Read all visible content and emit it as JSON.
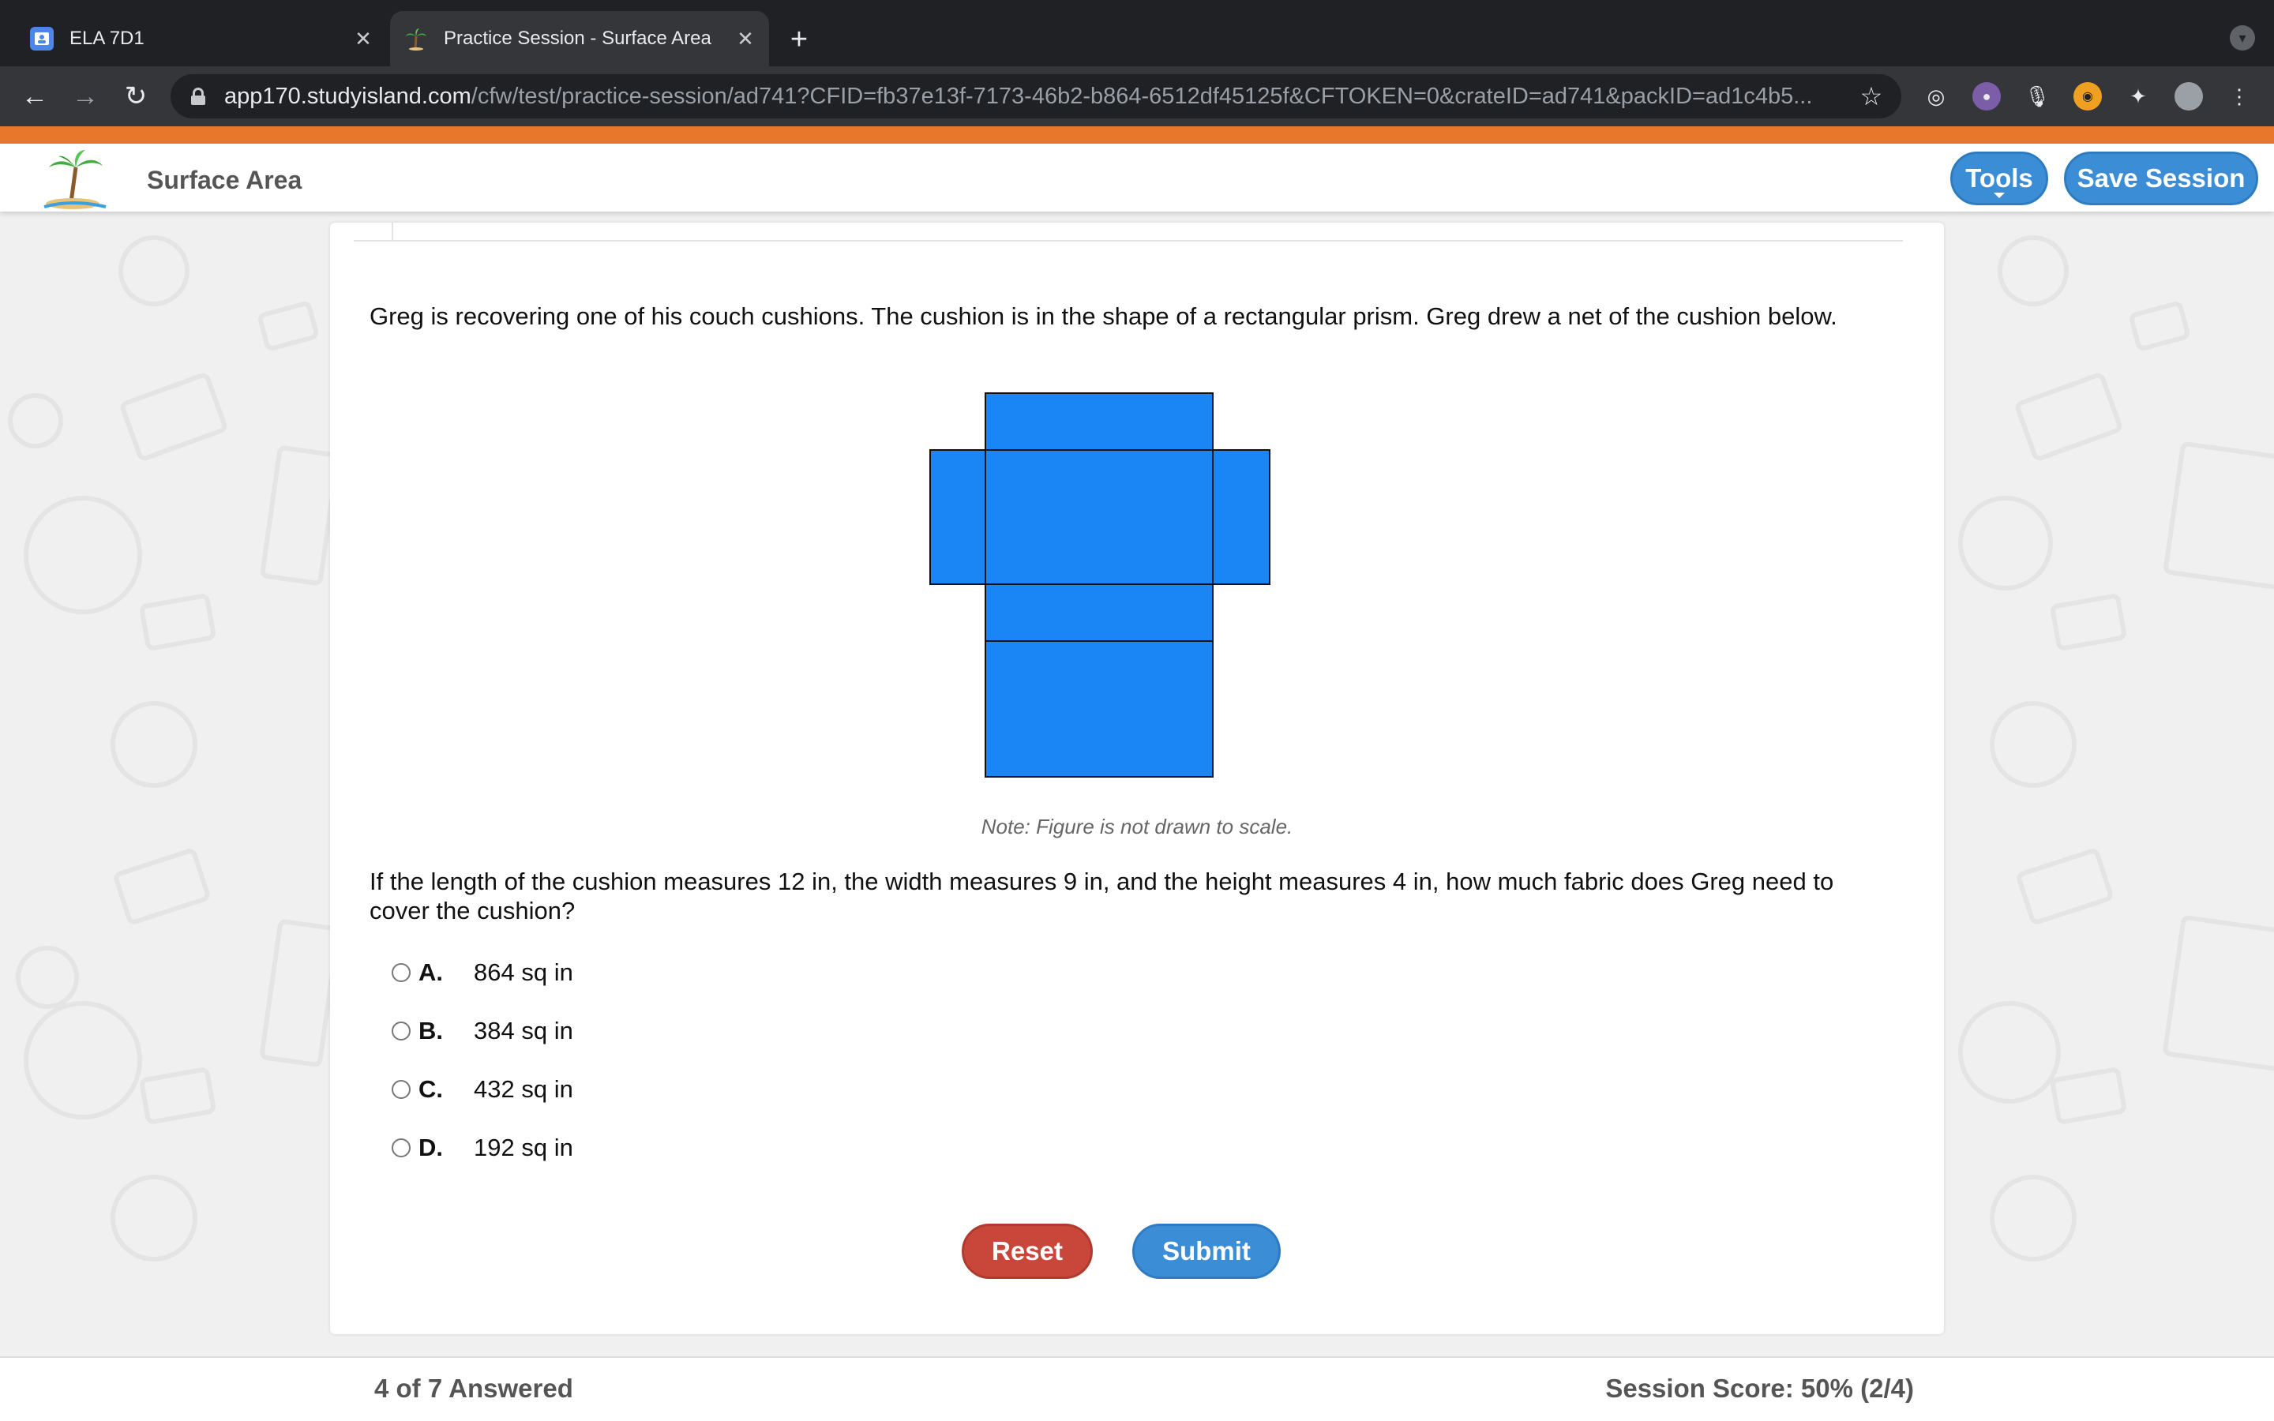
{
  "browser": {
    "tabs": [
      {
        "title": "ELA 7D1",
        "active": false,
        "favicon": "classroom-icon"
      },
      {
        "title": "Practice Session - Surface Area",
        "active": true,
        "favicon": "palm-tree-icon"
      }
    ],
    "new_tab_label": "+",
    "url_host": "app170.studyisland.com",
    "url_path": "/cfw/test/practice-session/ad741?CFID=fb37e13f-7173-46b2-b864-6512df45125f&CFTOKEN=0&crateID=ad741&packID=ad1c4b5..."
  },
  "header": {
    "title": "Surface Area",
    "tools_label": "Tools",
    "save_label": "Save Session",
    "accent_color": "#e8762b",
    "button_color": "#3b8ed6"
  },
  "question": {
    "stem": "Greg is recovering one of his couch cushions. The cushion is in the shape of a rectangular prism. Greg drew a net of the cushion below.",
    "figure_note": "Note: Figure is not drawn to scale.",
    "prompt": "If the length of the cushion measures 12 in, the width measures 9 in, and the height measures 4 in, how much fabric does Greg need to cover the cushion?",
    "net_color": "#1a86f5",
    "choices": [
      {
        "letter": "A.",
        "text": "864 sq in"
      },
      {
        "letter": "B.",
        "text": "384 sq in"
      },
      {
        "letter": "C.",
        "text": "432 sq in"
      },
      {
        "letter": "D.",
        "text": "192 sq in"
      }
    ]
  },
  "actions": {
    "reset_label": "Reset",
    "submit_label": "Submit"
  },
  "footer": {
    "answered": "4 of 7 Answered",
    "score": "Session Score: 50% (2/4)"
  }
}
